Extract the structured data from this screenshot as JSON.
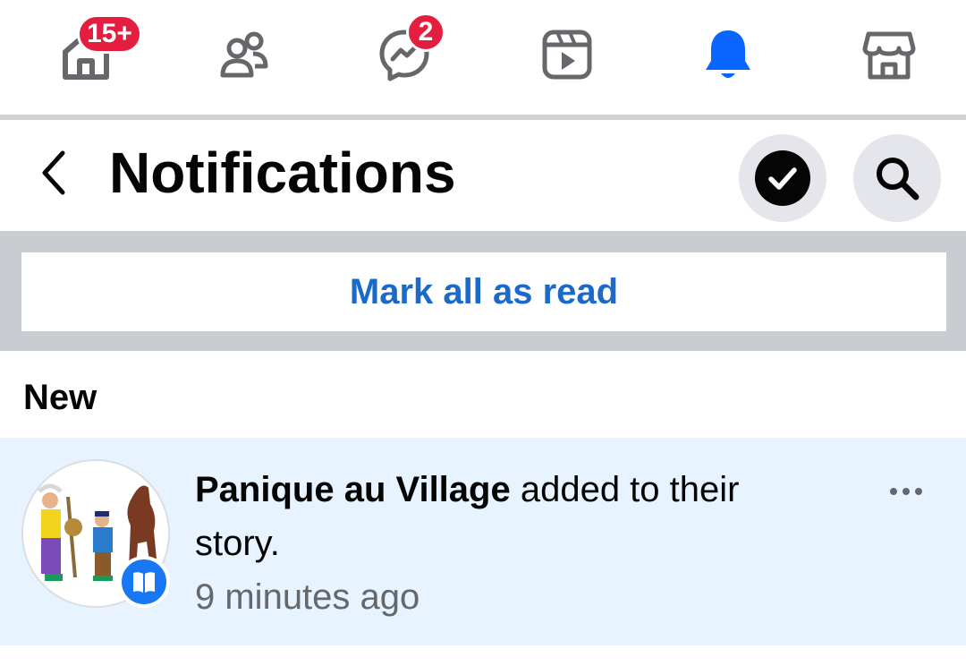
{
  "nav": {
    "home_badge": "15+",
    "messenger_badge": "2",
    "active_color": "#0866ff",
    "badge_color": "#e41e3f",
    "icons": [
      "home-icon",
      "friends-icon",
      "messenger-icon",
      "video-icon",
      "notifications-bell-icon",
      "marketplace-icon"
    ],
    "active_index": 4
  },
  "header": {
    "title": "Notifications"
  },
  "actions": {
    "mark_all_label": "Mark all as read"
  },
  "section": {
    "label": "New"
  },
  "notification": {
    "actor": "Panique au Village",
    "message": " added to their story.",
    "time": "9 minutes ago",
    "badge_icon": "story-book-icon"
  },
  "colors": {
    "link_blue": "#1b6ac9",
    "unread_bg": "#e7f3ff"
  }
}
